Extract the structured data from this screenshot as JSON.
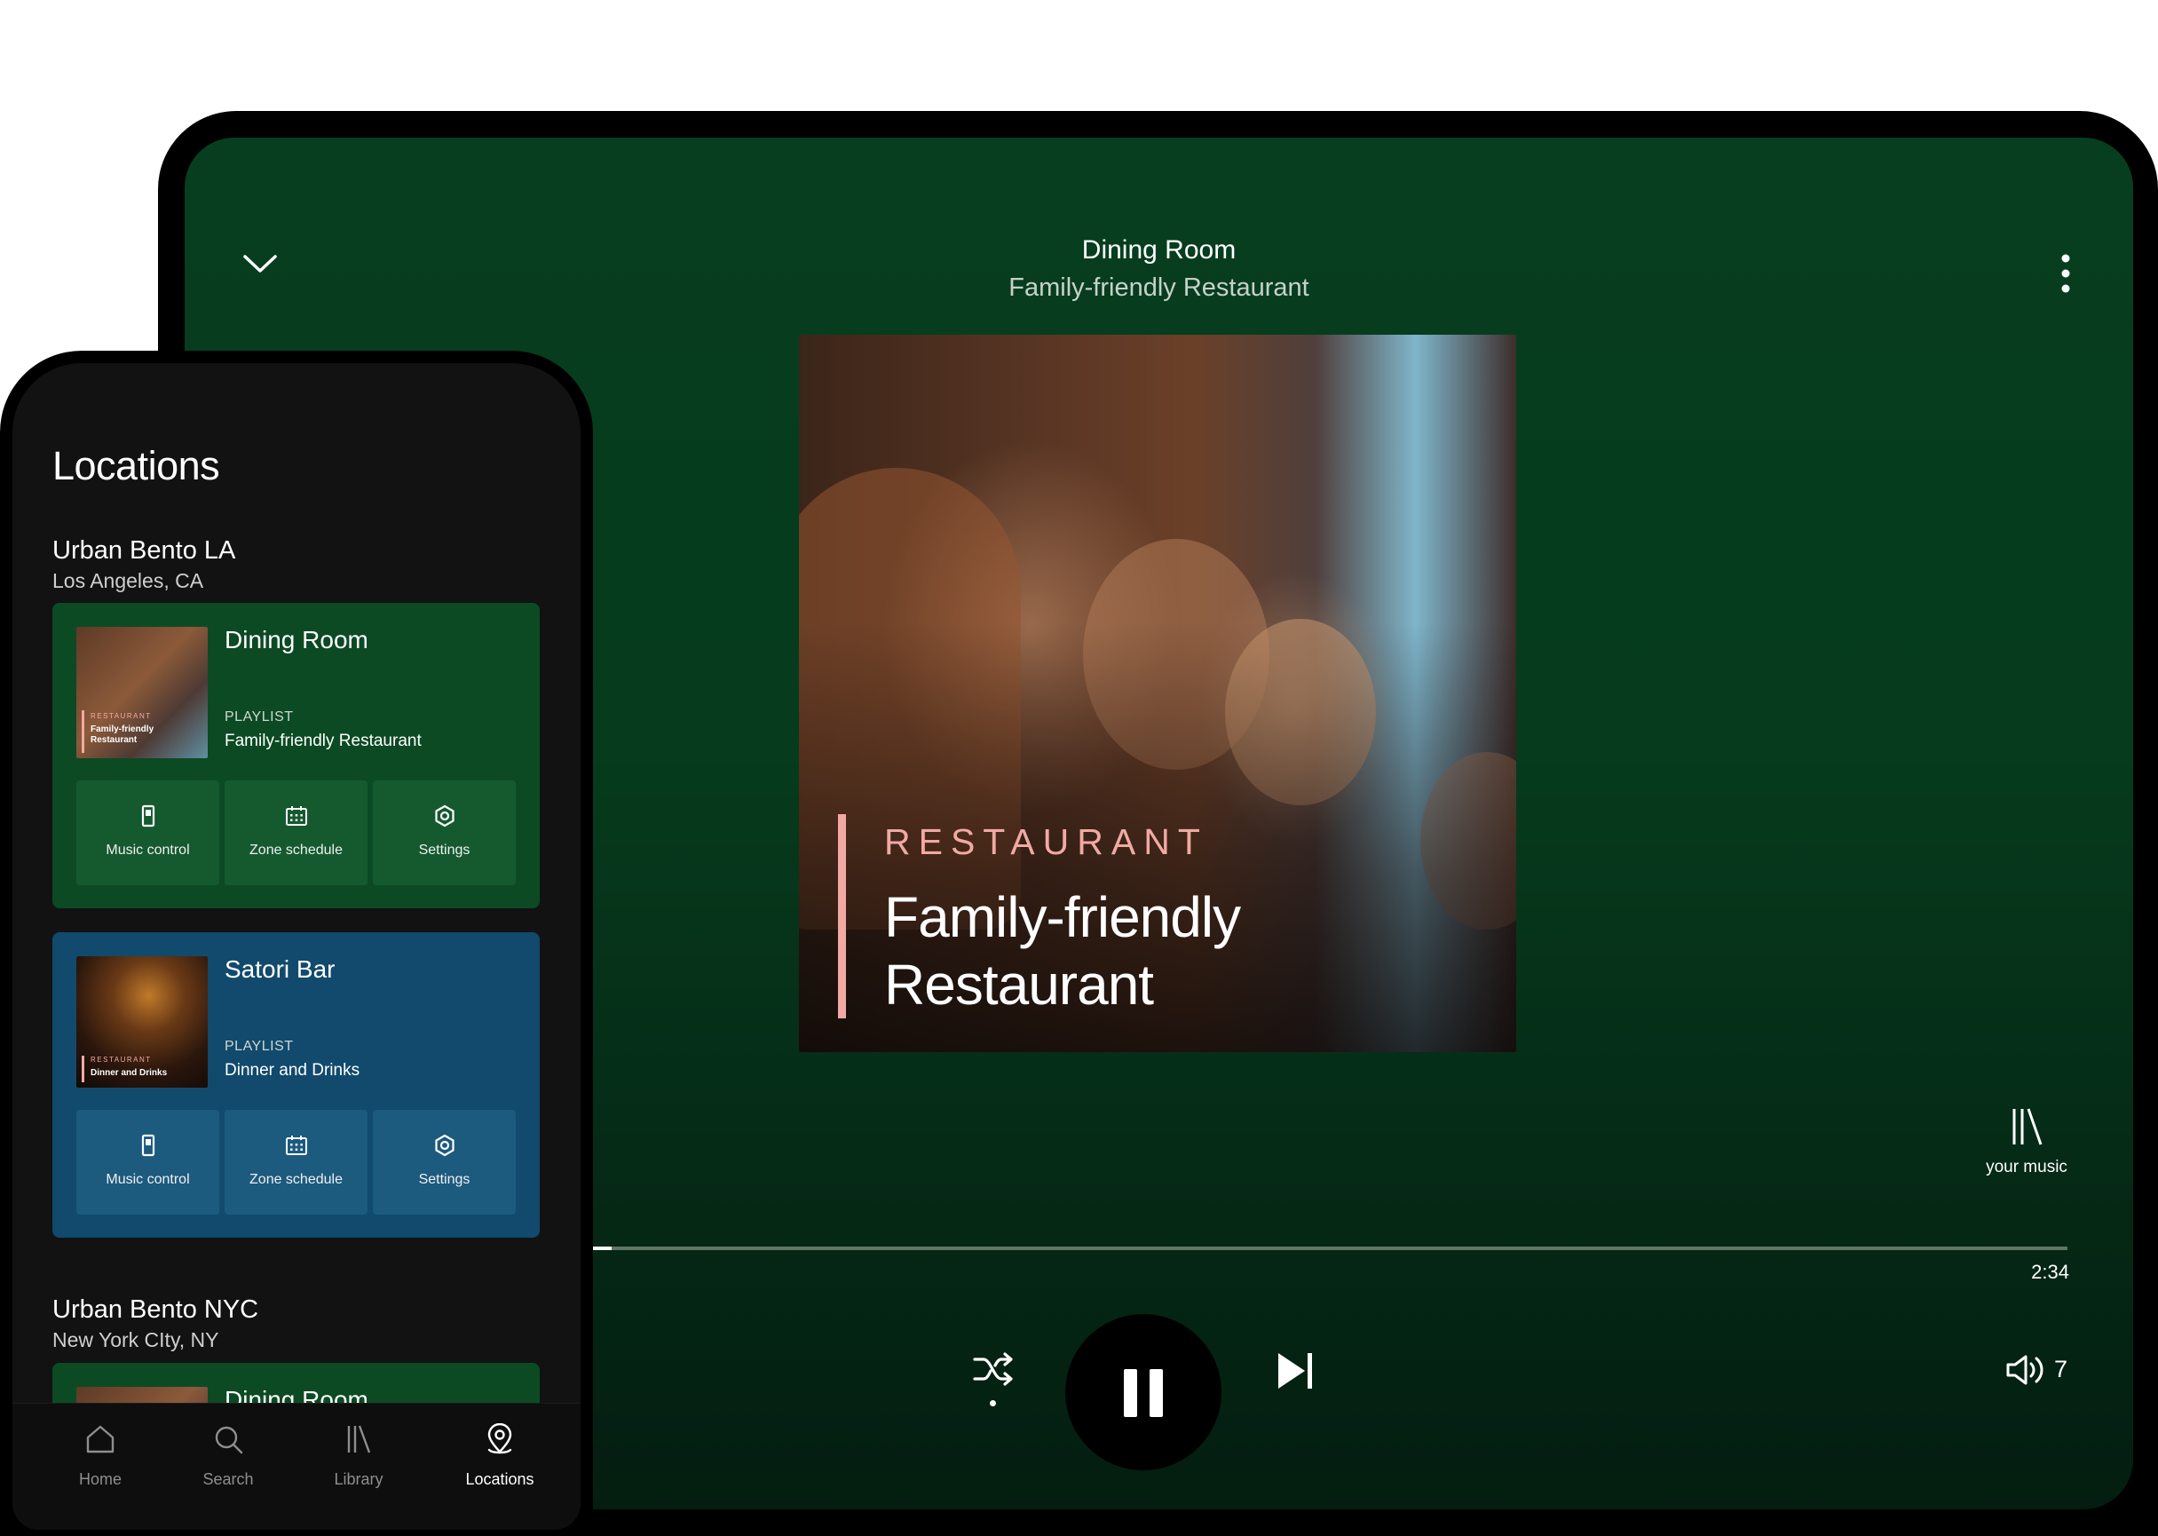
{
  "player": {
    "zone_name": "Dining Room",
    "playlist_name": "Family-friendly Restaurant",
    "artwork": {
      "category": "RESTAURANT",
      "title": "Family-friendly Restaurant"
    },
    "your_music_label": "your music",
    "progress_fraction": 0.03,
    "time_total": "2:34",
    "volume": "7",
    "state": "playing",
    "colors": {
      "background": "#073e1f",
      "accent": "#f2a9a3"
    }
  },
  "phone": {
    "title": "Locations",
    "locations": [
      {
        "name": "Urban Bento LA",
        "city": "Los Angeles, CA",
        "zones": [
          {
            "name": "Dining Room",
            "kind": "PLAYLIST",
            "playlist": "Family-friendly Restaurant",
            "thumb_category": "RESTAURANT",
            "thumb_title": "Family-friendly Restaurant",
            "color": "#0c4a24",
            "actions": [
              "Music control",
              "Zone schedule",
              "Settings"
            ]
          },
          {
            "name": "Satori Bar",
            "kind": "PLAYLIST",
            "playlist": "Dinner and Drinks",
            "thumb_category": "RESTAURANT",
            "thumb_title": "Dinner and Drinks",
            "color": "#114a6c",
            "actions": [
              "Music control",
              "Zone schedule",
              "Settings"
            ]
          }
        ]
      },
      {
        "name": "Urban Bento NYC",
        "city": "New York CIty, NY",
        "zones": [
          {
            "name": "Dining Room"
          }
        ]
      }
    ],
    "nav": [
      {
        "label": "Home",
        "icon": "home-icon"
      },
      {
        "label": "Search",
        "icon": "search-icon"
      },
      {
        "label": "Library",
        "icon": "library-icon"
      },
      {
        "label": "Locations",
        "icon": "location-pin-icon",
        "active": true
      }
    ]
  }
}
